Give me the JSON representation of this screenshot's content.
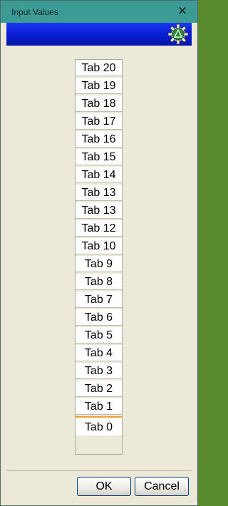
{
  "window": {
    "title": "Input Values",
    "close_glyph": "✕"
  },
  "banner": {
    "icon": "gear-icon",
    "colors": {
      "top": "#1c3af0",
      "bottom": "#0417a8"
    }
  },
  "tabs": [
    {
      "label": "Tab 20"
    },
    {
      "label": "Tab 19"
    },
    {
      "label": "Tab 18"
    },
    {
      "label": "Tab 17"
    },
    {
      "label": "Tab 16"
    },
    {
      "label": "Tab 15"
    },
    {
      "label": "Tab 14"
    },
    {
      "label": "Tab 13"
    },
    {
      "label": "Tab 13"
    },
    {
      "label": "Tab 12"
    },
    {
      "label": "Tab 10"
    },
    {
      "label": "Tab 9"
    },
    {
      "label": "Tab 8"
    },
    {
      "label": "Tab 7"
    },
    {
      "label": "Tab 6"
    },
    {
      "label": "Tab 5"
    },
    {
      "label": "Tab 4"
    },
    {
      "label": "Tab 3"
    },
    {
      "label": "Tab 2"
    },
    {
      "label": "Tab 1"
    },
    {
      "label": "Tab 0",
      "selected": true
    }
  ],
  "footer": {
    "ok_label": "OK",
    "cancel_label": "Cancel"
  }
}
